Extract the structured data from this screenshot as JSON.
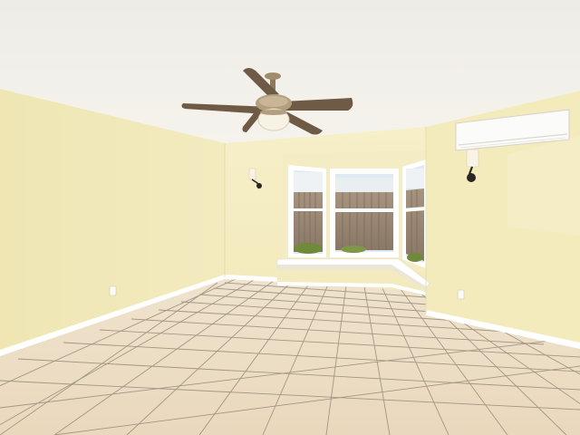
{
  "scene": {
    "subject": "empty room",
    "objects": [
      "ceiling-fan",
      "bay-window",
      "wall-mounted-ac-unit",
      "wall-sconce",
      "wall-sconce",
      "power-outlet",
      "power-outlet",
      "tile-floor",
      "baseboard"
    ]
  },
  "colors": {
    "ceiling": "#f1efe8",
    "wall_left": "#f0e8b8",
    "wall_back": "#f6efc6",
    "wall_right": "#f4ebbd",
    "floor": "#eedfc6",
    "grout": "#8a7f70",
    "trim": "#ffffff",
    "fence": "#9c8a78",
    "sky": "#dfe9f1",
    "foliage": "#6f8a3a"
  }
}
